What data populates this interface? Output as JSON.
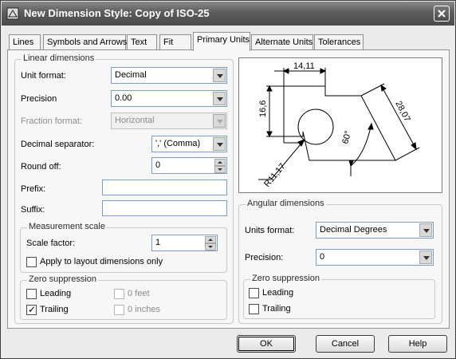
{
  "window": {
    "title": "New Dimension Style: Copy of ISO-25"
  },
  "tabs": [
    {
      "label": "Lines"
    },
    {
      "label": "Symbols and Arrows"
    },
    {
      "label": "Text"
    },
    {
      "label": "Fit"
    },
    {
      "label": "Primary Units"
    },
    {
      "label": "Alternate Units"
    },
    {
      "label": "Tolerances"
    }
  ],
  "linear": {
    "title": "Linear dimensions",
    "unit_format_label": "Unit format:",
    "unit_format_value": "Decimal",
    "precision_label": "Precision",
    "precision_value": "0.00",
    "fraction_label": "Fraction format:",
    "fraction_value": "Horizontal",
    "decimal_sep_label": "Decimal separator:",
    "decimal_sep_value": "',' (Comma)",
    "round_off_label": "Round off:",
    "round_off_value": "0",
    "prefix_label": "Prefix:",
    "prefix_value": "",
    "suffix_label": "Suffix:",
    "suffix_value": ""
  },
  "measurement": {
    "title": "Measurement scale",
    "scale_label": "Scale factor:",
    "scale_value": "1",
    "apply_layout_label": "Apply to layout dimensions only",
    "apply_layout_checked": false
  },
  "zero_linear": {
    "title": "Zero suppression",
    "leading_label": "Leading",
    "leading_checked": false,
    "trailing_label": "Trailing",
    "trailing_checked": true,
    "feet_label": "0 feet",
    "inches_label": "0 inches"
  },
  "preview": {
    "dim_top": "14,11",
    "dim_left": "16,6",
    "dim_right": "28,07",
    "dim_angle": "60°",
    "dim_radius": "R11,17"
  },
  "angular": {
    "title": "Angular dimensions",
    "units_label": "Units format:",
    "units_value": "Decimal Degrees",
    "precision_label": "Precision:",
    "precision_value": "0"
  },
  "zero_angular": {
    "title": "Zero suppression",
    "leading_label": "Leading",
    "leading_checked": false,
    "trailing_label": "Trailing",
    "trailing_checked": false
  },
  "buttons": {
    "ok": "OK",
    "cancel": "Cancel",
    "help": "Help"
  }
}
